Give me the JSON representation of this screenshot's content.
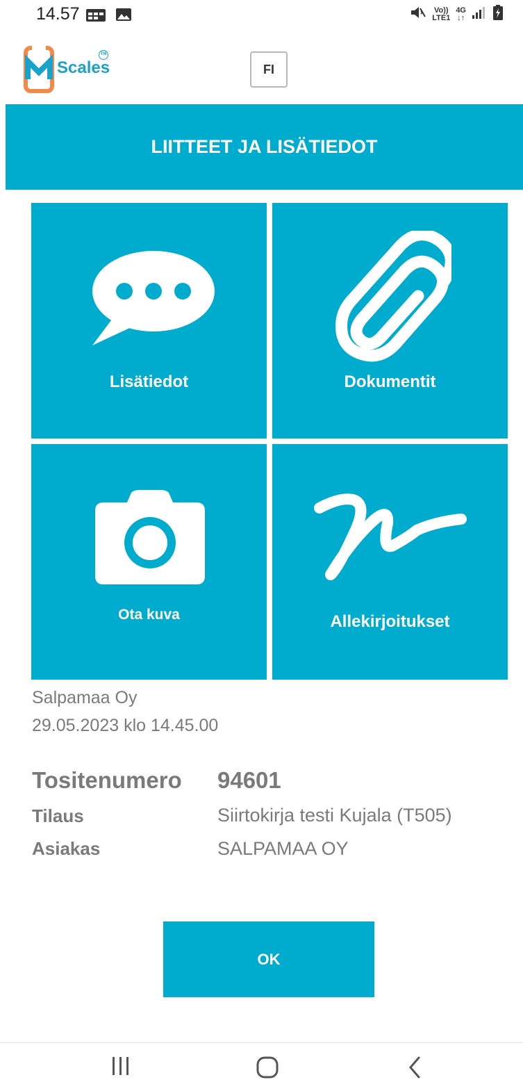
{
  "status_bar": {
    "time": "14.57",
    "network_top": "Vo))",
    "network_bottom": "LTE1",
    "network_type": "4G"
  },
  "header": {
    "logo_text": "Scales",
    "logo_tm": "TM",
    "language_button": "FI"
  },
  "page_title": "LIITTEET JA LISÄTIEDOT",
  "tiles": [
    {
      "label": "Lisätiedot",
      "icon": "speech-bubble-icon"
    },
    {
      "label": "Dokumentit",
      "icon": "paperclip-icon"
    },
    {
      "label": "Ota kuva",
      "icon": "camera-icon"
    },
    {
      "label": "Allekirjoitukset",
      "icon": "signature-icon"
    }
  ],
  "info": {
    "company": "Salpamaa Oy",
    "datetime": "29.05.2023 klo 14.45.00"
  },
  "fields": {
    "receipt_label": "Tositenumero",
    "receipt_value": "94601",
    "order_label": "Tilaus",
    "order_value": "Siirtokirja testi Kujala (T505)",
    "customer_label": "Asiakas",
    "customer_value": "SALPAMAA OY"
  },
  "ok_button": "OK",
  "colors": {
    "accent": "#00acce",
    "logo_orange": "#f08a4b",
    "logo_blue": "#1aa3c8",
    "text_gray": "#7a7a7a"
  }
}
